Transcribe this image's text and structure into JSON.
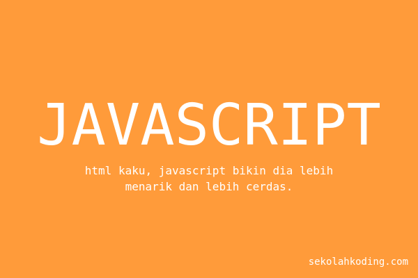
{
  "banner": {
    "background_color": "#ff9b3a",
    "text_color": "#ffffff",
    "headline": "JAVASCRIPT",
    "tagline_line_1": "html kaku, javascript bikin dia lebih",
    "tagline_line_2": "menarik dan lebih cerdas.",
    "site_url": "sekolahkoding.com"
  }
}
